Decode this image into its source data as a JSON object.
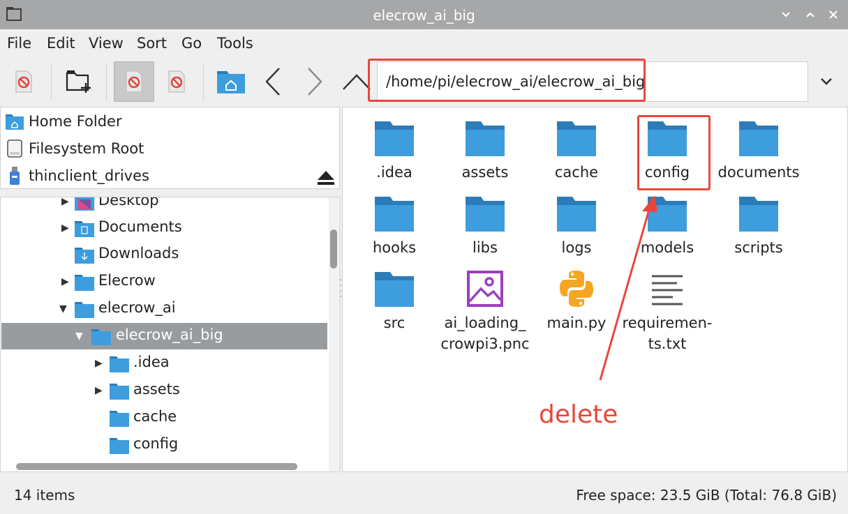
{
  "window": {
    "title": "elecrow_ai_big"
  },
  "menu": [
    "File",
    "Edit",
    "View",
    "Sort",
    "Go",
    "Tools"
  ],
  "toolbar": {
    "path": "/home/pi/elecrow_ai/elecrow_ai_big"
  },
  "places": [
    {
      "label": "Home Folder",
      "icon": "home-folder-icon"
    },
    {
      "label": "Filesystem Root",
      "icon": "drive-icon"
    },
    {
      "label": "thinclient_drives",
      "icon": "usb-drive-icon"
    }
  ],
  "tree": [
    {
      "label": "Desktop",
      "expander": "collapsed"
    },
    {
      "label": "Documents",
      "expander": "collapsed"
    },
    {
      "label": "Downloads",
      "expander": "none"
    },
    {
      "label": "Elecrow",
      "expander": "collapsed"
    },
    {
      "label": "elecrow_ai",
      "expander": "expanded"
    },
    {
      "label": "elecrow_ai_big",
      "expander": "expanded",
      "selected": true
    },
    {
      "label": ".idea",
      "expander": "collapsed"
    },
    {
      "label": "assets",
      "expander": "collapsed"
    },
    {
      "label": "cache",
      "expander": "none"
    },
    {
      "label": "config",
      "expander": "none"
    }
  ],
  "files": [
    {
      "name": ".idea",
      "type": "folder"
    },
    {
      "name": "assets",
      "type": "folder"
    },
    {
      "name": "cache",
      "type": "folder"
    },
    {
      "name": "config",
      "type": "folder"
    },
    {
      "name": "documents",
      "type": "folder"
    },
    {
      "name": "hooks",
      "type": "folder"
    },
    {
      "name": "libs",
      "type": "folder"
    },
    {
      "name": "logs",
      "type": "folder"
    },
    {
      "name": "models",
      "type": "folder"
    },
    {
      "name": "scripts",
      "type": "folder"
    },
    {
      "name": "src",
      "type": "folder"
    },
    {
      "name": "ai_loading_crowpi3.png",
      "display": "ai_loading_\ncrowpi3.pnc",
      "type": "image"
    },
    {
      "name": "main.py",
      "type": "python"
    },
    {
      "name": "requirements.txt",
      "display": "requiremen-\nts.txt",
      "type": "text"
    }
  ],
  "annotation": {
    "label": "delete",
    "color": "#e7473b"
  },
  "status": {
    "items": "14 items",
    "free_space": "Free space: 23.5 GiB (Total: 76.8 GiB)"
  },
  "colors": {
    "folder": "#3d9ddd",
    "folder_tab": "#2b7cb8",
    "selection": "#989c9f",
    "annotation": "#e7473b"
  }
}
